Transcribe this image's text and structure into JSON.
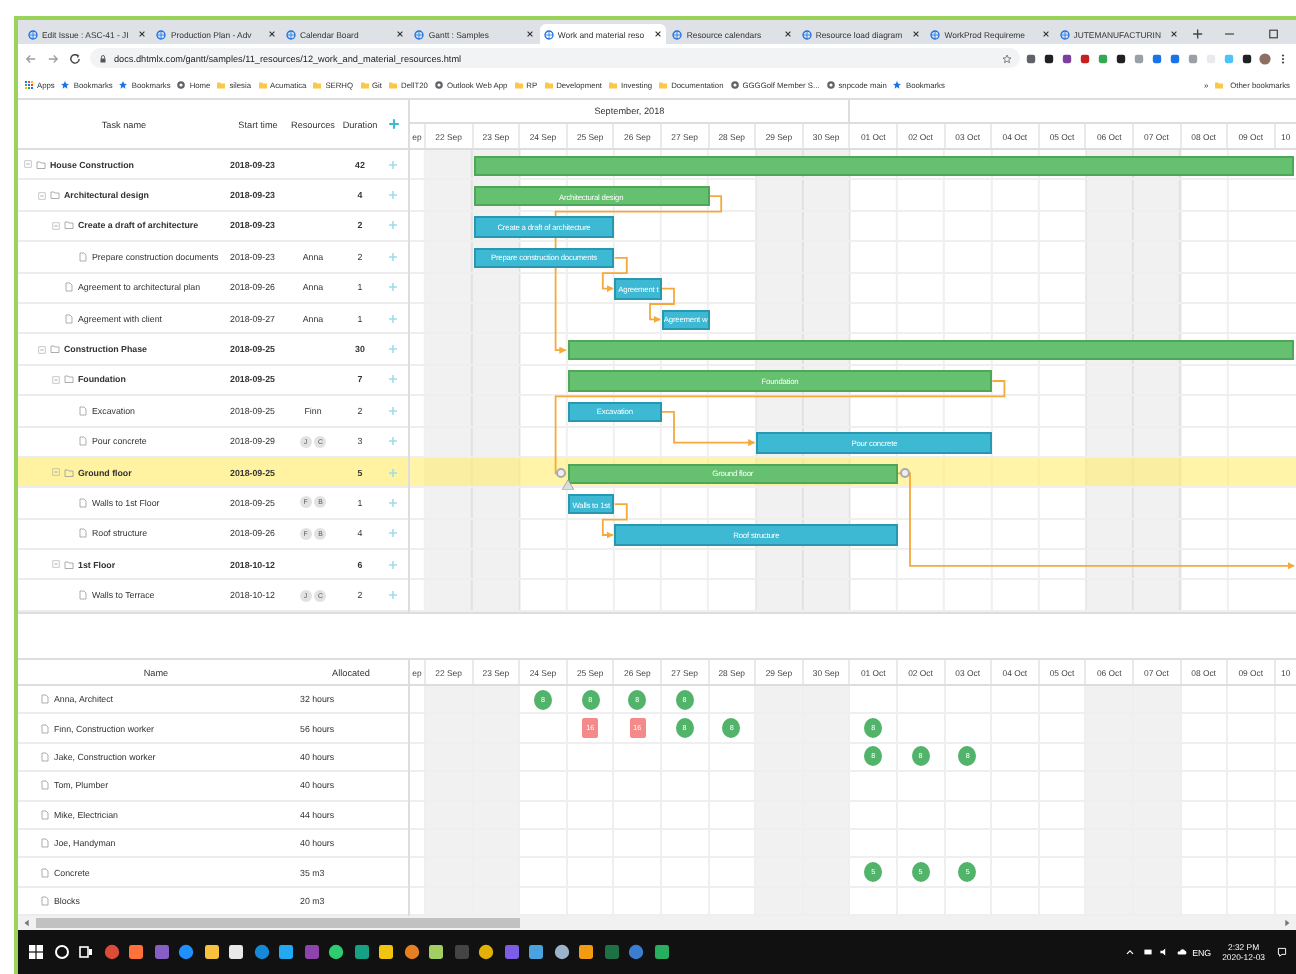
{
  "browser": {
    "tabs": [
      {
        "title": "Edit Issue : ASC-41 - JI",
        "selected": false
      },
      {
        "title": "Production Plan - Adv",
        "selected": false
      },
      {
        "title": "Calendar Board",
        "selected": false
      },
      {
        "title": "Gantt : Samples",
        "selected": false
      },
      {
        "title": "Work and material reso",
        "selected": true
      },
      {
        "title": "Resource calendars",
        "selected": false
      },
      {
        "title": "Resource load diagram",
        "selected": false
      },
      {
        "title": "WorkProd Requireme",
        "selected": false
      },
      {
        "title": "JUTEMANUFACTURIN",
        "selected": false
      }
    ],
    "address": "docs.dhtmlx.com/gantt/samples/11_resources/12_work_and_material_resources.html",
    "bookmarks": [
      {
        "label": "Apps",
        "kind": "apps"
      },
      {
        "label": "Bookmarks",
        "kind": "star"
      },
      {
        "label": "Bookmarks",
        "kind": "star"
      },
      {
        "label": "Home",
        "kind": "site"
      },
      {
        "label": "silesia",
        "kind": "folder"
      },
      {
        "label": "Acumatica",
        "kind": "folder"
      },
      {
        "label": "SERHQ",
        "kind": "folder"
      },
      {
        "label": "Git",
        "kind": "folder"
      },
      {
        "label": "DellT20",
        "kind": "folder"
      },
      {
        "label": "Outlook Web App",
        "kind": "site"
      },
      {
        "label": "RP",
        "kind": "folder"
      },
      {
        "label": "Development",
        "kind": "folder"
      },
      {
        "label": "Investing",
        "kind": "folder"
      },
      {
        "label": "Documentation",
        "kind": "folder"
      },
      {
        "label": "GGGGolf Member S...",
        "kind": "site"
      },
      {
        "label": "snpcode main",
        "kind": "site"
      },
      {
        "label": "Bookmarks",
        "kind": "star"
      }
    ],
    "overflow": "»",
    "other_bookmarks": "Other bookmarks"
  },
  "gantt": {
    "columns": [
      "Task name",
      "Start time",
      "Resources",
      "Duration"
    ],
    "month": "September, 2018",
    "days": [
      "ep",
      "22 Sep",
      "23 Sep",
      "24 Sep",
      "25 Sep",
      "26 Sep",
      "27 Sep",
      "28 Sep",
      "29 Sep",
      "30 Sep",
      "01 Oct",
      "02 Oct",
      "03 Oct",
      "04 Oct",
      "05 Oct",
      "06 Oct",
      "07 Oct",
      "08 Oct",
      "09 Oct",
      "10"
    ],
    "tasks": [
      {
        "name": "House Construction",
        "start": "2018-09-23",
        "duration": "42",
        "kind": "project",
        "bar": {
          "kind": "project"
        },
        "selected": false,
        "expanded": true,
        "children": [
          {
            "name": "Architectural design",
            "start": "2018-09-23",
            "duration": "4",
            "kind": "project",
            "bar": {
              "kind": "project",
              "label": "Architectural design"
            },
            "selected": false,
            "expanded": true,
            "children": [
              {
                "name": "Create a draft of architecture",
                "start": "2018-09-23",
                "duration": "2",
                "kind": "project",
                "bar": {
                  "kind": "task",
                  "label": "Create a draft of architecture"
                },
                "selected": false,
                "expanded": true,
                "children": [
                  {
                    "name": "Prepare construction documents",
                    "start": "2018-09-23",
                    "resources": "Anna",
                    "duration": "2",
                    "kind": "task",
                    "bar": {
                      "kind": "task",
                      "label": "Prepare construction documents"
                    },
                    "selected": false
                  }
                ]
              },
              {
                "name": "Agreement to architectural plan",
                "start": "2018-09-26",
                "resources": "Anna",
                "duration": "1",
                "kind": "task",
                "bar": {
                  "kind": "task",
                  "label": "Agreement t"
                },
                "selected": false
              },
              {
                "name": "Agreement with client",
                "start": "2018-09-27",
                "resources": "Anna",
                "duration": "1",
                "kind": "task",
                "bar": {
                  "kind": "task",
                  "label": "Agreement w"
                },
                "selected": false
              }
            ]
          },
          {
            "name": "Construction Phase",
            "start": "2018-09-25",
            "duration": "30",
            "kind": "project",
            "bar": {
              "kind": "project"
            },
            "selected": false,
            "expanded": true,
            "children": [
              {
                "name": "Foundation",
                "start": "2018-09-25",
                "duration": "7",
                "kind": "project",
                "bar": {
                  "kind": "project",
                  "label": "Foundation"
                },
                "selected": false,
                "expanded": true,
                "children": [
                  {
                    "name": "Excavation",
                    "start": "2018-09-25",
                    "resources": "Finn",
                    "duration": "2",
                    "kind": "task",
                    "bar": {
                      "kind": "task",
                      "label": "Excavation"
                    },
                    "selected": false
                  },
                  {
                    "name": "Pour concrete",
                    "start": "2018-09-29",
                    "resource_badges": [
                      "J",
                      "C"
                    ],
                    "duration": "3",
                    "kind": "task",
                    "bar": {
                      "kind": "task",
                      "label": "Pour concrete"
                    },
                    "selected": false
                  }
                ]
              },
              {
                "name": "Ground floor",
                "start": "2018-09-25",
                "duration": "5",
                "kind": "project",
                "bar": {
                  "kind": "project",
                  "label": "Ground floor"
                },
                "selected": true,
                "expanded": true,
                "children": [
                  {
                    "name": "Walls to 1st Floor",
                    "start": "2018-09-25",
                    "resource_badges": [
                      "F",
                      "B"
                    ],
                    "duration": "1",
                    "kind": "task",
                    "bar": {
                      "kind": "task",
                      "label": "Walls to 1st"
                    },
                    "selected": false
                  },
                  {
                    "name": "Roof structure",
                    "start": "2018-09-26",
                    "resource_badges": [
                      "F",
                      "B"
                    ],
                    "duration": "4",
                    "kind": "task",
                    "bar": {
                      "kind": "task",
                      "label": "Roof structure"
                    },
                    "selected": false
                  }
                ]
              },
              {
                "name": "1st Floor",
                "start": "2018-10-12",
                "duration": "6",
                "kind": "project",
                "selected": false,
                "expanded": true,
                "children": [
                  {
                    "name": "Walls to Terrace",
                    "start": "2018-10-12",
                    "resource_badges": [
                      "J",
                      "C"
                    ],
                    "duration": "2",
                    "kind": "task",
                    "selected": false
                  }
                ]
              }
            ]
          }
        ]
      }
    ]
  },
  "resources": {
    "columns": [
      "Name",
      "Allocated"
    ],
    "days": [
      "ep",
      "22 Sep",
      "23 Sep",
      "24 Sep",
      "25 Sep",
      "26 Sep",
      "27 Sep",
      "28 Sep",
      "29 Sep",
      "30 Sep",
      "01 Oct",
      "02 Oct",
      "03 Oct",
      "04 Oct",
      "05 Oct",
      "06 Oct",
      "07 Oct",
      "08 Oct",
      "09 Oct",
      "10"
    ],
    "rows": [
      {
        "name": "Anna, Architect",
        "allocated": "32 hours",
        "cells": [
          {
            "kind": "empty"
          },
          {
            "kind": "empty"
          },
          {
            "kind": "empty"
          },
          {
            "kind": "load",
            "value": "8",
            "over": false
          },
          {
            "kind": "load",
            "value": "8",
            "over": false
          },
          {
            "kind": "load",
            "value": "8",
            "over": false
          },
          {
            "kind": "load",
            "value": "8",
            "over": false
          },
          {
            "kind": "empty"
          },
          {
            "kind": "empty"
          },
          {
            "kind": "empty"
          },
          {
            "kind": "empty"
          },
          {
            "kind": "empty"
          },
          {
            "kind": "empty"
          },
          {
            "kind": "empty"
          },
          {
            "kind": "empty"
          },
          {
            "kind": "empty"
          },
          {
            "kind": "empty"
          },
          {
            "kind": "empty"
          },
          {
            "kind": "empty"
          },
          {
            "kind": "empty"
          }
        ]
      },
      {
        "name": "Finn, Construction worker",
        "allocated": "56 hours",
        "cells": [
          {
            "kind": "empty"
          },
          {
            "kind": "empty"
          },
          {
            "kind": "empty"
          },
          {
            "kind": "empty"
          },
          {
            "kind": "load",
            "value": "16",
            "over": true
          },
          {
            "kind": "load",
            "value": "16",
            "over": true
          },
          {
            "kind": "load",
            "value": "8",
            "over": false
          },
          {
            "kind": "load",
            "value": "8",
            "over": false
          },
          {
            "kind": "empty"
          },
          {
            "kind": "empty"
          },
          {
            "kind": "load",
            "value": "8",
            "over": false
          },
          {
            "kind": "empty"
          },
          {
            "kind": "empty"
          },
          {
            "kind": "empty"
          },
          {
            "kind": "empty"
          },
          {
            "kind": "empty"
          },
          {
            "kind": "empty"
          },
          {
            "kind": "empty"
          },
          {
            "kind": "empty"
          },
          {
            "kind": "empty"
          }
        ]
      },
      {
        "name": "Jake, Construction worker",
        "allocated": "40 hours",
        "cells": [
          {
            "kind": "empty"
          },
          {
            "kind": "empty"
          },
          {
            "kind": "empty"
          },
          {
            "kind": "empty"
          },
          {
            "kind": "empty"
          },
          {
            "kind": "empty"
          },
          {
            "kind": "empty"
          },
          {
            "kind": "empty"
          },
          {
            "kind": "empty"
          },
          {
            "kind": "empty"
          },
          {
            "kind": "load",
            "value": "8",
            "over": false
          },
          {
            "kind": "load",
            "value": "8",
            "over": false
          },
          {
            "kind": "load",
            "value": "8",
            "over": false
          },
          {
            "kind": "empty"
          },
          {
            "kind": "empty"
          },
          {
            "kind": "empty"
          },
          {
            "kind": "empty"
          },
          {
            "kind": "empty"
          },
          {
            "kind": "empty"
          },
          {
            "kind": "empty"
          }
        ]
      },
      {
        "name": "Tom, Plumber",
        "allocated": "40 hours"
      },
      {
        "name": "Mike, Electrician",
        "allocated": "44 hours"
      },
      {
        "name": "Joe, Handyman",
        "allocated": "40 hours"
      },
      {
        "name": "Concrete",
        "allocated": "35 m3",
        "cells": [
          {
            "kind": "empty"
          },
          {
            "kind": "empty"
          },
          {
            "kind": "empty"
          },
          {
            "kind": "empty"
          },
          {
            "kind": "empty"
          },
          {
            "kind": "empty"
          },
          {
            "kind": "empty"
          },
          {
            "kind": "empty"
          },
          {
            "kind": "empty"
          },
          {
            "kind": "empty"
          },
          {
            "kind": "load",
            "value": "5",
            "over": false
          },
          {
            "kind": "load",
            "value": "5",
            "over": false
          },
          {
            "kind": "load",
            "value": "5",
            "over": false
          },
          {
            "kind": "empty"
          },
          {
            "kind": "empty"
          },
          {
            "kind": "empty"
          },
          {
            "kind": "empty"
          },
          {
            "kind": "empty"
          },
          {
            "kind": "empty"
          },
          {
            "kind": "empty"
          }
        ]
      },
      {
        "name": "Blocks",
        "allocated": "20 m3"
      }
    ]
  },
  "taskbar": {
    "language": "ENG",
    "time": "2:32 PM",
    "date": "2020-12-03"
  }
}
